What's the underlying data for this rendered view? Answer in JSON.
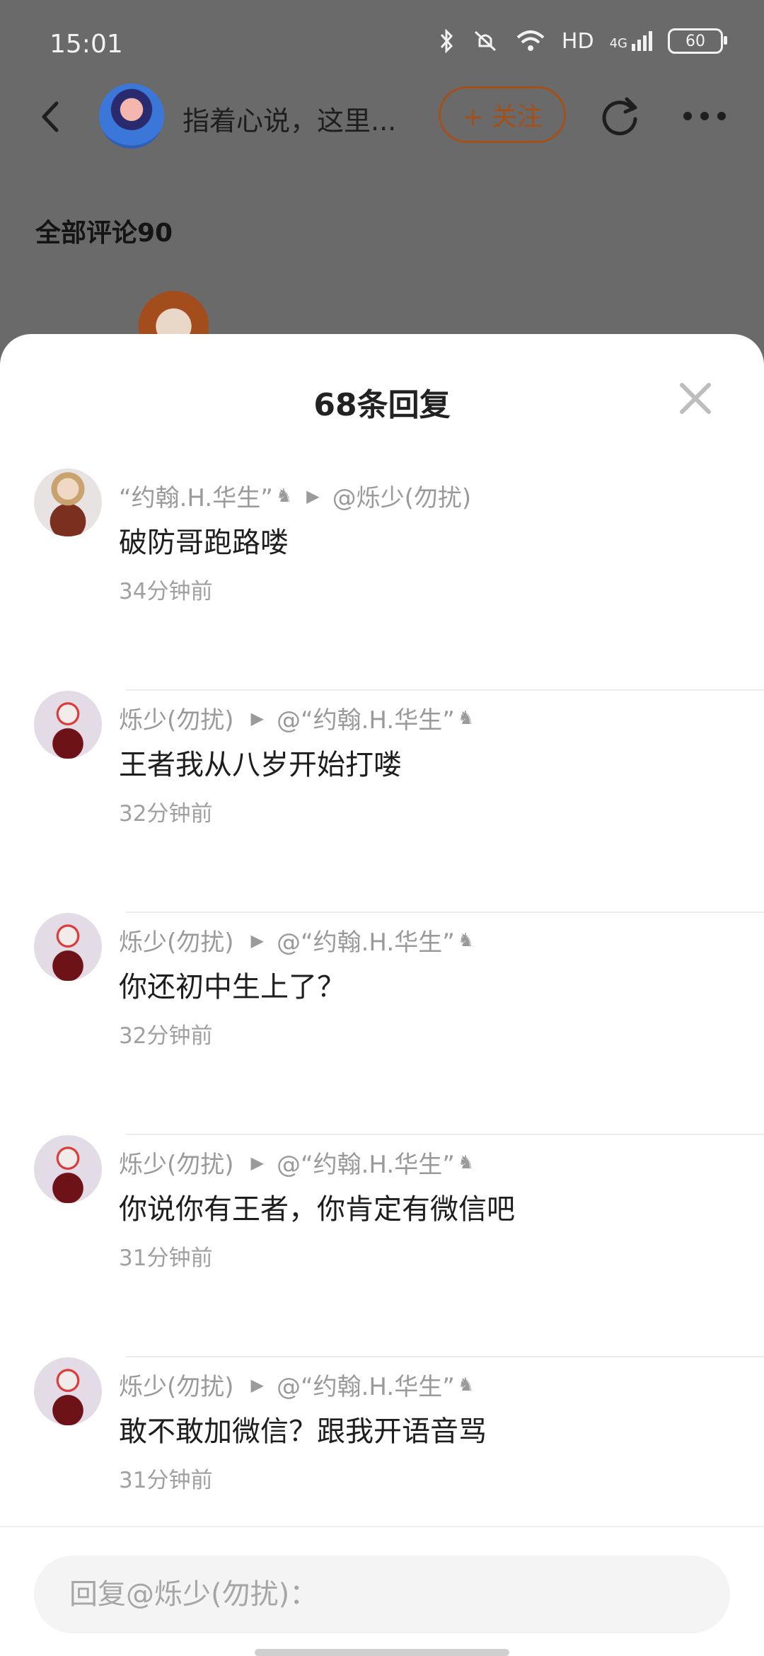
{
  "status_bar": {
    "time": "15:01",
    "network_label": "HD",
    "signal_label": "4G",
    "battery": "60"
  },
  "header": {
    "title": "指着心说，这里...",
    "follow_label": "+ 关注"
  },
  "background": {
    "all_comments_label": "全部评论90"
  },
  "sheet": {
    "title": "68条回复"
  },
  "replies": [
    {
      "author": "“约翰.H.华生”",
      "author_icon": "♞",
      "target": "@烁少(勿扰)",
      "target_icon": "",
      "text": "破防哥跑路喽",
      "time": "34分钟前"
    },
    {
      "author": "烁少(勿扰)",
      "author_icon": "",
      "target": "@“约翰.H.华生”",
      "target_icon": "♞",
      "text": "王者我从八岁开始打喽",
      "time": "32分钟前"
    },
    {
      "author": "烁少(勿扰)",
      "author_icon": "",
      "target": "@“约翰.H.华生”",
      "target_icon": "♞",
      "text": "你还初中生上了？",
      "time": "32分钟前"
    },
    {
      "author": "烁少(勿扰)",
      "author_icon": "",
      "target": "@“约翰.H.华生”",
      "target_icon": "♞",
      "text": "你说你有王者，你肯定有微信吧",
      "time": "31分钟前"
    },
    {
      "author": "烁少(勿扰)",
      "author_icon": "",
      "target": "@“约翰.H.华生”",
      "target_icon": "♞",
      "text": "敢不敢加微信？跟我开语音骂",
      "time": "31分钟前"
    }
  ],
  "reply_input": {
    "placeholder": "回复@烁少(勿扰)："
  },
  "colors": {
    "accent_follow": "#a3501a",
    "dim_background": "#6a6a6a",
    "meta_gray": "#9a9a9a"
  }
}
